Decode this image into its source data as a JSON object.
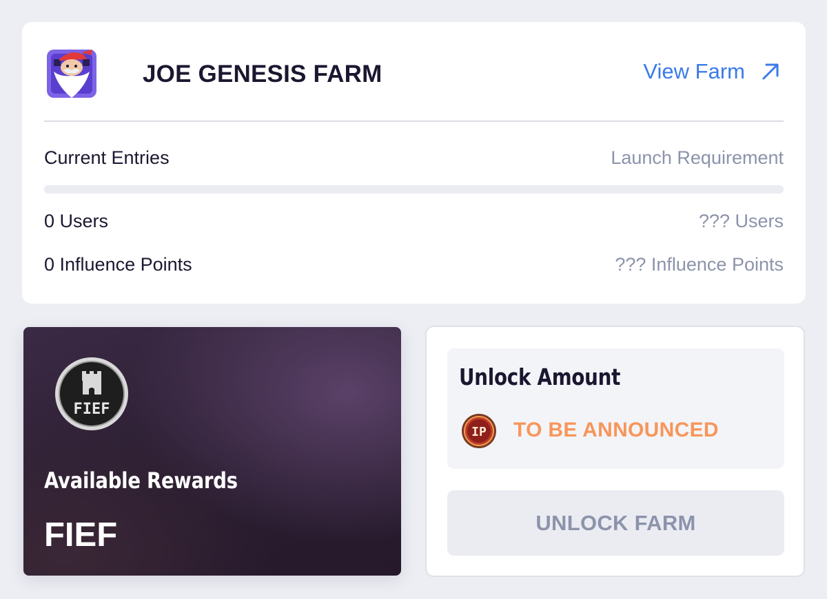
{
  "farm": {
    "title": "JOE GENESIS FARM",
    "view_link_label": "View Farm",
    "view_link_icon": "arrow-up-right-icon",
    "avatar_icon": "joe-avatar-icon",
    "current_entries_label": "Current Entries",
    "launch_requirement_label": "Launch Requirement",
    "progress_fraction": 0,
    "current_users": "0 Users",
    "current_influence": "0 Influence Points",
    "required_users": "??? Users",
    "required_influence": "??? Influence Points"
  },
  "rewards": {
    "label": "Available Rewards",
    "token": "FIEF",
    "coin_icon": "fief-coin-icon",
    "coin_text": "FIEF"
  },
  "unlock": {
    "title": "Unlock Amount",
    "currency_icon": "influence-points-coin-icon",
    "coin_text": "IP",
    "amount": "TO BE ANNOUNCED",
    "button_label": "UNLOCK FARM"
  },
  "colors": {
    "background": "#eceef4",
    "link": "#3b7be8",
    "muted": "#8c93ab",
    "announce": "#f7965a",
    "rewards_card": "#2f2236"
  }
}
